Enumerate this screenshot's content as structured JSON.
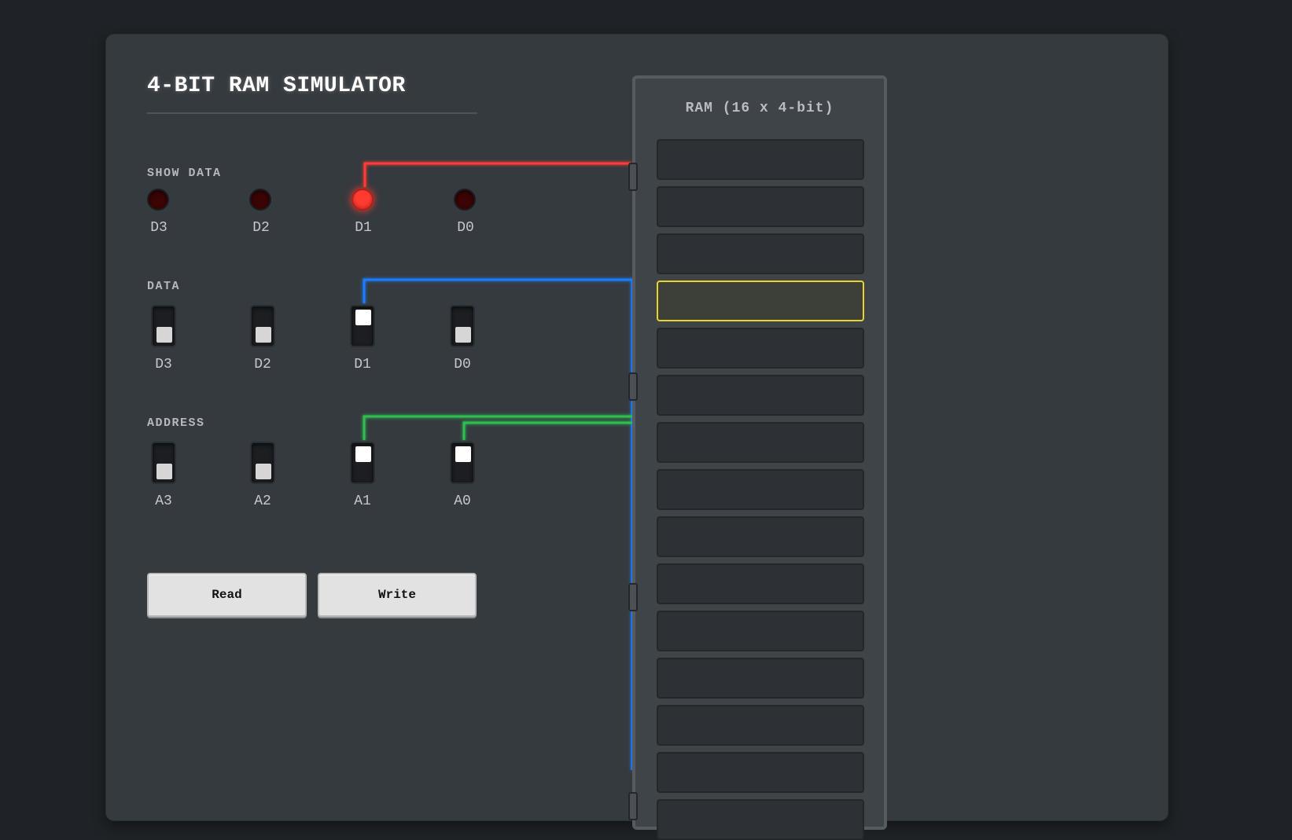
{
  "title": "4-BIT RAM SIMULATOR",
  "sections": {
    "show_data": "SHOW DATA",
    "data": "DATA",
    "address": "ADDRESS"
  },
  "show_data": [
    {
      "label": "D3",
      "on": false
    },
    {
      "label": "D2",
      "on": false
    },
    {
      "label": "D1",
      "on": true
    },
    {
      "label": "D0",
      "on": false
    }
  ],
  "data_switches": [
    {
      "label": "D3",
      "on": false
    },
    {
      "label": "D2",
      "on": false
    },
    {
      "label": "D1",
      "on": true
    },
    {
      "label": "D0",
      "on": false
    }
  ],
  "address_switches": [
    {
      "label": "A3",
      "on": false
    },
    {
      "label": "A2",
      "on": false
    },
    {
      "label": "A1",
      "on": true
    },
    {
      "label": "A0",
      "on": true
    }
  ],
  "buttons": {
    "read": "Read",
    "write": "Write"
  },
  "ram": {
    "title": "RAM (16 x 4-bit)",
    "selected_address": 3
  },
  "colors": {
    "panel": "#353a3f",
    "led_on": "#ff3b30",
    "data_wire": "#1e7bff",
    "address_wire": "#2fbf4f",
    "show_wire": "#ff3b30",
    "selected_cell": "#e9d42a"
  }
}
